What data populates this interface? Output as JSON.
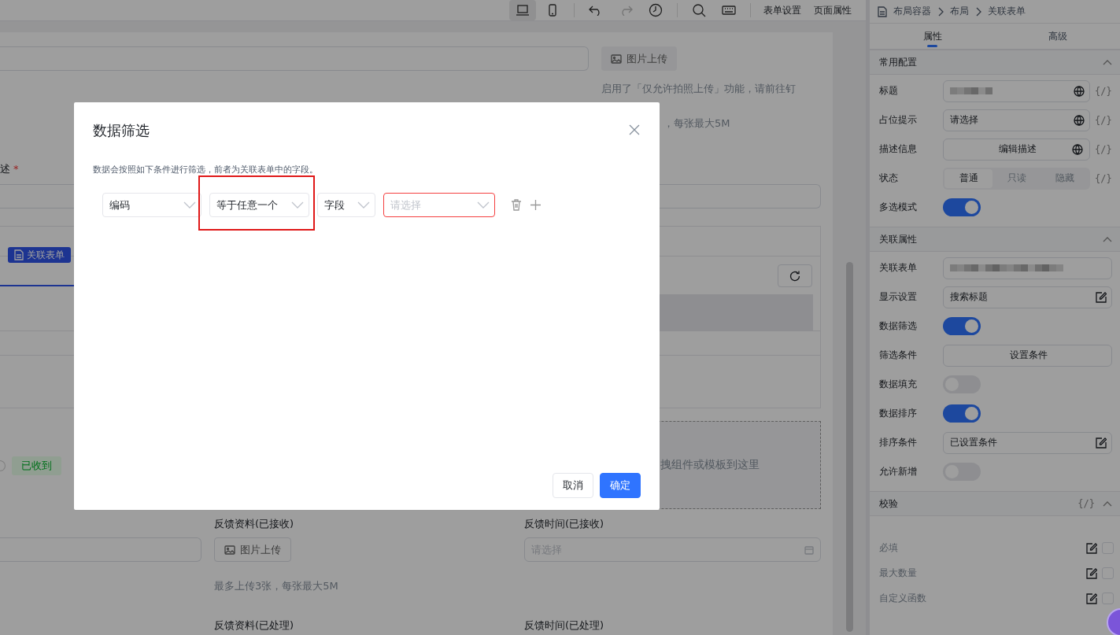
{
  "toolbar": {
    "views": [
      {
        "selected": true
      },
      {
        "selected": false
      }
    ],
    "history": [
      {
        "disabled": false
      },
      {
        "disabled": true
      }
    ],
    "links": [
      "表单设置",
      "页面属性"
    ]
  },
  "canvas": {
    "upload": "图片上传",
    "hint": "启用了「仅允许拍照上传」功能，请前往钉",
    "limit": "，每张最大5M",
    "field_label": "述",
    "required_mark": "*",
    "subform_tag": "关联表单",
    "status_radio": {
      "checked": false
    },
    "status_tag": "已收到",
    "drop_hint": "拽组件或模板到这里",
    "fields": [
      {
        "label": "反馈资料(已接收)",
        "kind": "upload",
        "button": "图片上传",
        "hint": "最多上传3张，每张最大5M"
      },
      {
        "label": "反馈时间(已接收)",
        "kind": "date",
        "placeholder": "请选择"
      }
    ],
    "next_labels": [
      "反馈资料(已处理)",
      "反馈时间(已处理)"
    ]
  },
  "panel": {
    "breadcrumb": [
      "布局容器",
      "布局",
      "关联表单"
    ],
    "tabs": [
      {
        "label": "属性",
        "selected": true
      },
      {
        "label": "高级",
        "selected": false
      }
    ],
    "sections": [
      {
        "title": "常用配置",
        "expanded": true,
        "rows": [
          {
            "label": "标题",
            "kind": "redacted",
            "globe": true,
            "binding": "{/}"
          },
          {
            "label": "占位提示",
            "kind": "input",
            "value": "请选择",
            "globe": true,
            "binding": "{/}"
          },
          {
            "label": "描述信息",
            "kind": "button-globe",
            "value": "编辑描述",
            "binding": "{/}"
          },
          {
            "label": "状态",
            "kind": "segmented",
            "options": [
              {
                "label": "普通",
                "selected": true
              },
              {
                "label": "只读",
                "selected": false
              },
              {
                "label": "隐藏",
                "selected": false
              }
            ],
            "binding": "{/}"
          },
          {
            "label": "多选模式",
            "kind": "switch",
            "on": true
          }
        ]
      },
      {
        "title": "关联属性",
        "expanded": true,
        "rows": [
          {
            "label": "关联表单",
            "kind": "redacted-select"
          },
          {
            "label": "显示设置",
            "kind": "edit",
            "value": "搜索标题"
          },
          {
            "label": "数据筛选",
            "kind": "switch",
            "on": true
          },
          {
            "label": "筛选条件",
            "kind": "button",
            "value": "设置条件"
          },
          {
            "label": "数据填充",
            "kind": "switch",
            "on": false
          },
          {
            "label": "数据排序",
            "kind": "switch",
            "on": true
          },
          {
            "label": "排序条件",
            "kind": "edit",
            "value": "已设置条件"
          },
          {
            "label": "允许新增",
            "kind": "switch",
            "on": false
          }
        ]
      },
      {
        "title": "校验",
        "expanded": true,
        "binding": "{/}",
        "rows": [
          {
            "label": "必填",
            "kind": "check",
            "checked": false
          },
          {
            "label": "最大数量",
            "kind": "check",
            "checked": false
          },
          {
            "label": "自定义函数",
            "kind": "check",
            "checked": false
          }
        ]
      }
    ]
  },
  "dialog": {
    "title": "数据筛选",
    "description": "数据会按照如下条件进行筛选，前者为关联表单中的字段。",
    "conditions": [
      {
        "value": "编码",
        "highlighted": false,
        "error": false
      },
      {
        "value": "等于任意一个",
        "highlighted": true,
        "error": false
      },
      {
        "value": "字段",
        "highlighted": false,
        "error": false
      },
      {
        "placeholder": "请选择",
        "highlighted": false,
        "error": true
      }
    ],
    "buttons": [
      {
        "label": "取消",
        "kind": "default"
      },
      {
        "label": "确定",
        "kind": "primary"
      }
    ]
  }
}
